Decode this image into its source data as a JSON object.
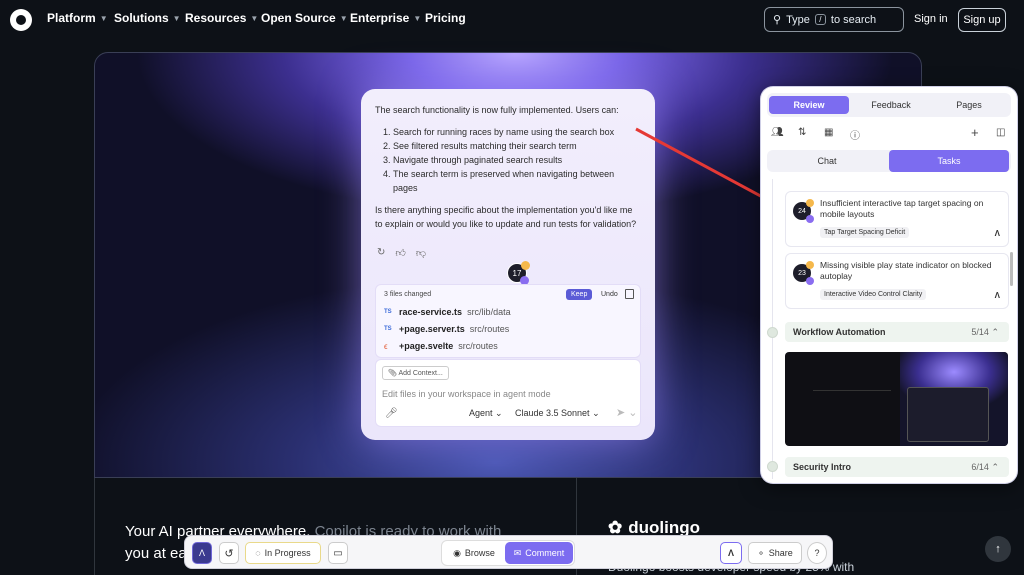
{
  "topnav": {
    "items": [
      {
        "label": "Platform",
        "has_dropdown": true
      },
      {
        "label": "Solutions",
        "has_dropdown": true
      },
      {
        "label": "Resources",
        "has_dropdown": true
      },
      {
        "label": "Open Source",
        "has_dropdown": true
      },
      {
        "label": "Enterprise",
        "has_dropdown": true
      },
      {
        "label": "Pricing",
        "has_dropdown": false
      }
    ],
    "search_label_before": "Type",
    "search_key": "/",
    "search_label_after": "to search",
    "signin": "Sign in",
    "signup": "Sign up"
  },
  "chat": {
    "intro": "The search functionality is now fully implemented. Users can:",
    "steps": [
      "Search for running races by name using the search box",
      "See filtered results matching their search term",
      "Navigate through paginated search results",
      "The search term is preserved when navigating between pages"
    ],
    "question": "Is there anything specific about the implementation you'd like me to explain or would you like to update and run tests for validation?",
    "avatar_number": "17",
    "files_changed": "3 files changed",
    "keep": "Keep",
    "undo": "Undo",
    "files": [
      {
        "type": "TS",
        "name": "race-service.ts",
        "path": "src/lib/data"
      },
      {
        "type": "TS",
        "name": "+page.server.ts",
        "path": "src/routes"
      },
      {
        "type": "svelte",
        "name": "+page.svelte",
        "path": "src/routes"
      }
    ],
    "add_context": "Add Context...",
    "input_placeholder": "Edit files in your workspace in agent mode",
    "agent": "Agent",
    "model": "Claude 3.5 Sonnet"
  },
  "lower": {
    "tagline_bold": "Your AI partner everywhere.",
    "tagline_dim": "Copilot is ready to work with",
    "tagline_line2": "you at ea",
    "duolingo": "duolingo",
    "duolingo_sub": "Duolingo boosts developer speed by 25% with"
  },
  "panel": {
    "tabs": [
      "Review",
      "Feedback",
      "Pages"
    ],
    "active_tab": "Review",
    "tools": [
      "users-icon",
      "sort-icon",
      "image-icon",
      "info-icon",
      "plus-icon",
      "sidebar-icon"
    ],
    "subtabs": [
      "Chat",
      "Tasks"
    ],
    "active_subtab": "Tasks",
    "tasks": [
      {
        "number": "24",
        "title": "Insufficient interactive tap target spacing on mobile layouts",
        "chip": "Tap Target Spacing Deficit"
      },
      {
        "number": "23",
        "title": "Missing visible play state indicator on blocked autoplay",
        "chip": "Interactive Video Control Clarity"
      }
    ],
    "sections": [
      {
        "label": "Workflow Automation",
        "count": "5/14"
      },
      {
        "label": "Security Intro",
        "count": "6/14"
      }
    ]
  },
  "bottombar": {
    "status": "In Progress",
    "browse": "Browse",
    "comment": "Comment",
    "share": "Share",
    "help": "?"
  },
  "colors": {
    "accent": "#7c6cf0",
    "page_bg": "#0d1117",
    "annotation_arrow": "#e53935"
  }
}
